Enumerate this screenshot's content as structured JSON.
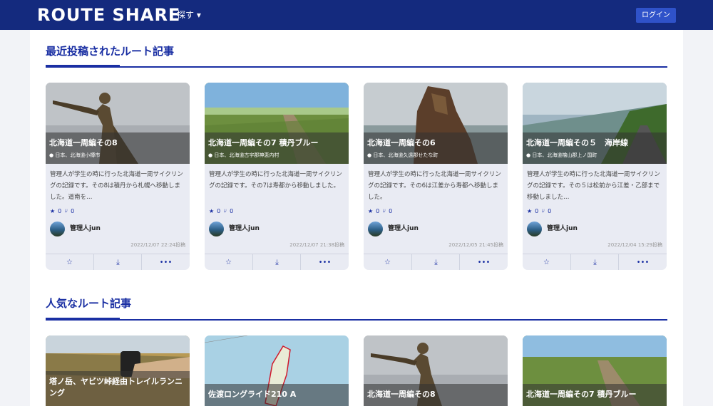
{
  "header": {
    "logo": "ROUTE SHARE",
    "explore": "探す ▾",
    "login": "ログイン"
  },
  "sections": [
    {
      "title": "最近投稿されたルート記事"
    },
    {
      "title": "人気なルート記事"
    }
  ],
  "recent": [
    {
      "title": "北海道一周編その8",
      "location": "日本、北海道小樽市",
      "desc": "管理人が学生の時に行った北海道一周サイクリングの記録です。その8は積丹から札幌へ移動しました。道南を…",
      "likes": "0",
      "forks": "0",
      "author": "管理人jun",
      "posted": "2022/12/07 22:24投稿"
    },
    {
      "title": "北海道一周編その7 積丹ブルー",
      "location": "日本、北海道古宇郡神恵内村",
      "desc": "管理人が学生の時に行った北海道一周サイクリングの記録です。その7は寿都から移動しました。",
      "likes": "0",
      "forks": "0",
      "author": "管理人jun",
      "posted": "2022/12/07 21:38投稿"
    },
    {
      "title": "北海道一周編その6",
      "location": "日本、北海道久遠郡せたな町",
      "desc": "管理人が学生の時に行った北海道一周サイクリングの記録です。その6は江差から寿都へ移動しました。",
      "likes": "0",
      "forks": "0",
      "author": "管理人jun",
      "posted": "2022/12/05 21:45投稿"
    },
    {
      "title": "北海道一周編その５　海岸線",
      "location": "日本、北海道檜山郡上ノ国町",
      "desc": "管理人が学生の時に行った北海道一周サイクリングの記録です。その５は松前から江差・乙部まで移動しました…",
      "likes": "0",
      "forks": "0",
      "author": "管理人jun",
      "posted": "2022/12/04 15:29投稿"
    }
  ],
  "popular": [
    {
      "title": "塔ノ岳、ヤビツ峠経由トレイルランニング"
    },
    {
      "title": "佐渡ロングライド210 A"
    },
    {
      "title": "北海道一周編その8"
    },
    {
      "title": "北海道一周編その7 積丹ブルー"
    }
  ],
  "icons": {
    "star": "star-icon",
    "fork": "fork-icon",
    "pin": "map-pin-icon",
    "download": "download-icon",
    "more": "more-icon"
  },
  "colors": {
    "navbar": "#142a7e",
    "accent": "#1a2fa3",
    "card": "#e9ebf3"
  }
}
